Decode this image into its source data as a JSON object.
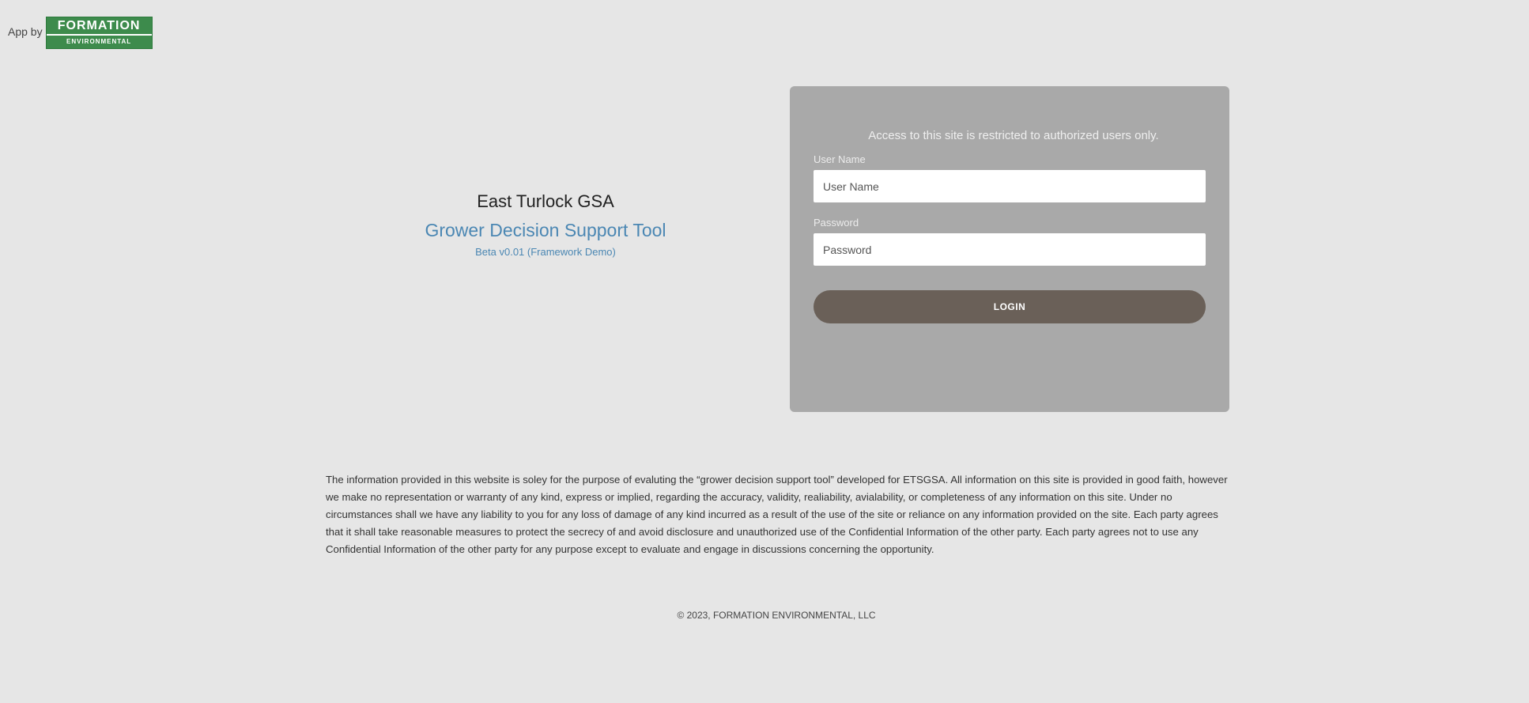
{
  "brand": {
    "prefix": "App by",
    "logo_top": "FORMATION",
    "logo_bottom": "ENVIRONMENTAL"
  },
  "header": {
    "org": "East Turlock GSA",
    "app_name": "Grower Decision Support Tool",
    "version": "Beta v0.01 (Framework Demo)"
  },
  "login": {
    "notice": "Access to this site is restricted to authorized users only.",
    "username_label": "User Name",
    "username_placeholder": "User Name",
    "username_value": "",
    "password_label": "Password",
    "password_placeholder": "Password",
    "password_value": "",
    "button_label": "LOGIN"
  },
  "disclaimer": "The information provided in this website is soley for the purpose of evaluting the “grower decision support tool” developed for ETSGSA. All information on this site is provided in good faith, however we make no representation or warranty of any kind, express or implied, regarding the accuracy, validity, realiability, avialability, or completeness of any information on this site. Under no circumstances shall we have any liability to you for any loss of damage of any kind incurred as a result of the use of the site or reliance on any information provided on the site. Each party agrees that it shall take reasonable measures to protect the secrecy of and avoid disclosure and unauthorized use of the Confidential Information of the other party. Each party agrees not to use any Confidential Information of the other party for any purpose except to evaluate and engage in discussions concerning the opportunity.",
  "footer": {
    "copyright": "© 2023, FORMATION ENVIRONMENTAL, LLC"
  },
  "colors": {
    "background": "#e6e6e6",
    "card": "#a9a9a9",
    "button": "#6a6058",
    "accent_blue": "#4b87b3",
    "logo_green": "#3d8b4c"
  }
}
